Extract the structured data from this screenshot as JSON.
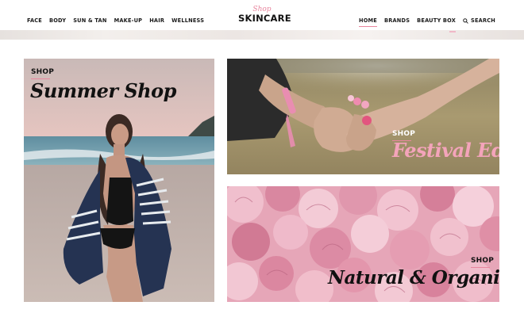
{
  "header": {
    "nav_left": [
      "FACE",
      "BODY",
      "SUN & TAN",
      "MAKE-UP",
      "HAIR",
      "WELLNESS"
    ],
    "logo": {
      "top": "Shop",
      "main": "SKINCARE"
    },
    "nav_right": {
      "home": "HOME",
      "brands": "BRANDS",
      "beauty_box": "BEAUTY BOX",
      "search": "SEARCH"
    }
  },
  "tiles": {
    "summer": {
      "tag": "SHOP",
      "title": "Summer Shop"
    },
    "festival": {
      "tag": "SHOP",
      "title": "Festival Edit"
    },
    "natural": {
      "tag": "SHOP",
      "title": "Natural & Organic"
    }
  },
  "colors": {
    "accent": "#e8869e",
    "festival_title": "#f4a4bb",
    "text": "#111111"
  },
  "icons": {
    "search": "search-icon"
  }
}
